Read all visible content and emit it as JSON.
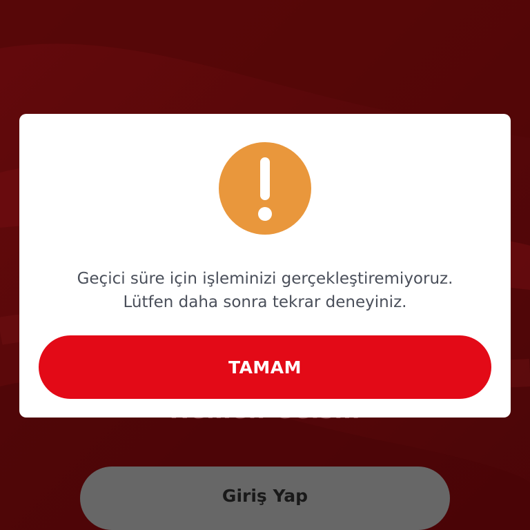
{
  "colors": {
    "background": "#6e0a0c",
    "dialog": "#ffffff",
    "alert_icon": "#e9973c",
    "primary_button": "#e30a17",
    "secondary_button": "#7e7e7e",
    "message_text": "#4a4f5a"
  },
  "background_screen": {
    "obscured_text": "Hemen Gelsin",
    "login_button_label": "Giriş Yap"
  },
  "dialog": {
    "icon": "exclamation-icon",
    "message_line_1": "Geçici süre için işleminizi gerçekleştiremiyoruz.",
    "message_line_2": "Lütfen daha sonra tekrar deneyiniz.",
    "ok_button_label": "TAMAM"
  }
}
